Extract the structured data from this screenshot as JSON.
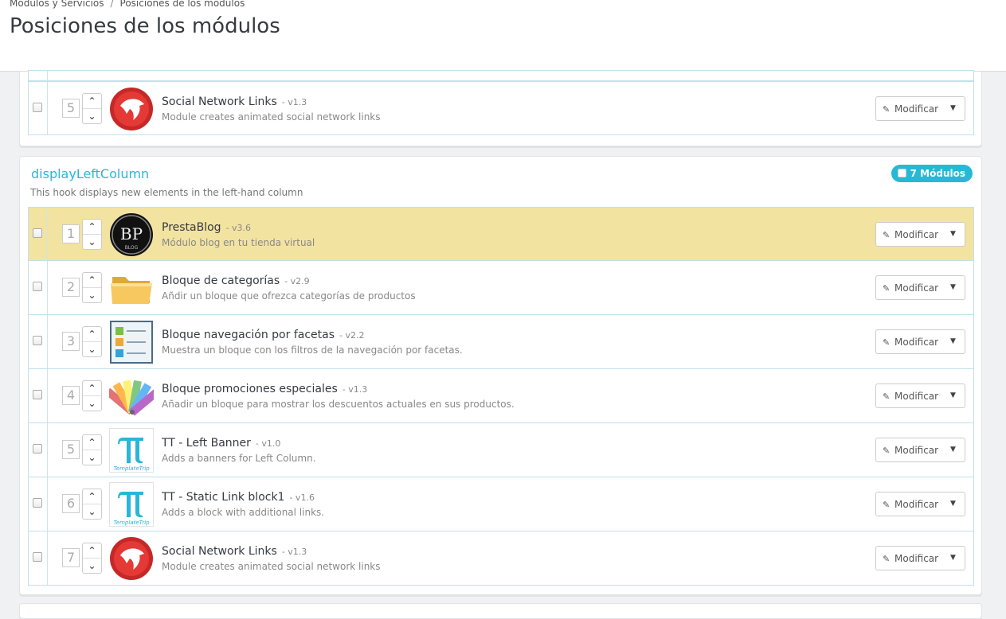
{
  "breadcrumb": {
    "parent": "Módulos y Servicios",
    "separator": "/",
    "current": "Posiciones de los módulos"
  },
  "page_title": "Posiciones de los módulos",
  "colors": {
    "accent": "#25b9d7",
    "highlight_row": "#f3e3a0",
    "row_border": "#bfe1ec"
  },
  "modify_label": "Modificar",
  "top_section": {
    "rows": [
      {
        "position": "5",
        "name": "Social Network Links",
        "version": "- v1.3",
        "description": "Module creates animated social network links",
        "icon": "social-network-icon"
      }
    ]
  },
  "left_column": {
    "title": "displayLeftColumn",
    "description": "This hook displays new elements in the left-hand column",
    "count_label": "7 Módulos",
    "rows": [
      {
        "position": "1",
        "name": "PrestaBlog",
        "version": "- v3.6",
        "description": "Módulo blog en tu tienda virtual",
        "icon": "prestablog-icon",
        "highlighted": true
      },
      {
        "position": "2",
        "name": "Bloque de categorías",
        "version": "- v2.9",
        "description": "Añdir un bloque que ofrezca categorías de productos",
        "icon": "folder-icon"
      },
      {
        "position": "3",
        "name": "Bloque navegación por facetas",
        "version": "- v2.2",
        "description": "Muestra un bloque con los filtros de la navegación por facetas.",
        "icon": "faceted-list-icon"
      },
      {
        "position": "4",
        "name": "Bloque promociones especiales",
        "version": "- v1.3",
        "description": "Añadir un bloque para mostrar los descuentos actuales en sus productos.",
        "icon": "color-swatch-icon"
      },
      {
        "position": "5",
        "name": "TT - Left Banner",
        "version": "- v1.0",
        "description": "Adds a banners for Left Column.",
        "icon": "templatetrip-icon",
        "logo_text": "TemplateTrip"
      },
      {
        "position": "6",
        "name": "TT - Static Link block1",
        "version": "- v1.6",
        "description": "Adds a block with additional links.",
        "icon": "templatetrip-icon",
        "logo_text": "TemplateTrip"
      },
      {
        "position": "7",
        "name": "Social Network Links",
        "version": "- v1.3",
        "description": "Module creates animated social network links",
        "icon": "social-network-icon"
      }
    ]
  }
}
